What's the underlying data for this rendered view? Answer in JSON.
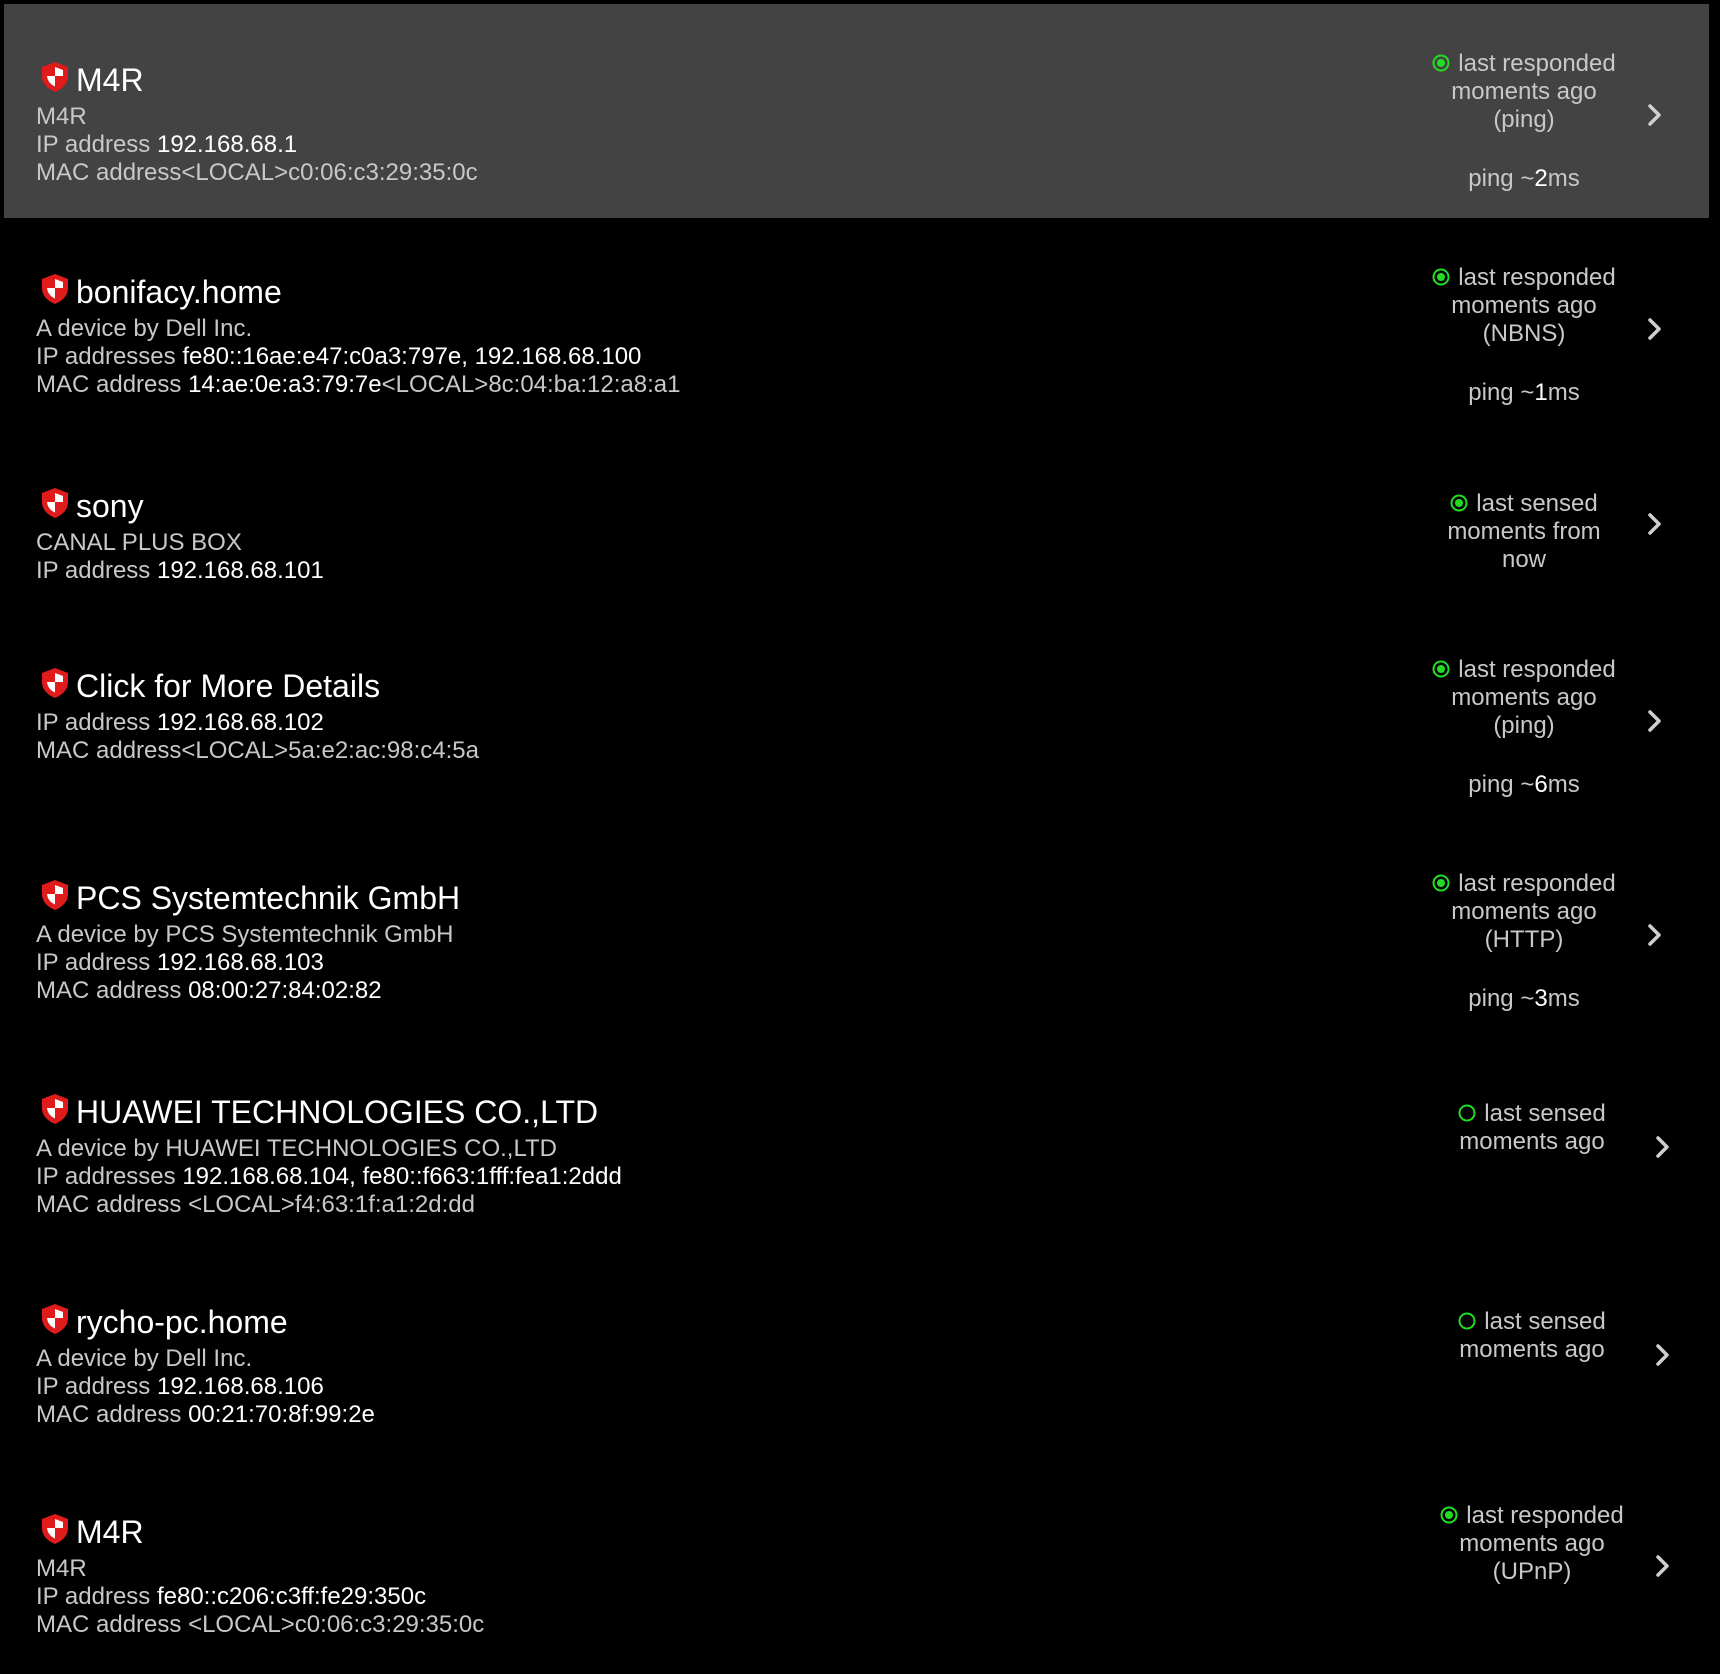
{
  "colors": {
    "background": "#000000",
    "selected_row": "#434343",
    "status_green": "#22dd22",
    "shield_red": "#e01b1b",
    "secondary_text": "#c8c8c8",
    "primary_text": "#ffffff"
  },
  "devices": [
    {
      "name": "M4R",
      "subtitle": "M4R",
      "ip_label": "IP address ",
      "ip_value": "192.168.68.1",
      "mac_label": "MAC address",
      "mac_primary": "",
      "mac_local": "<LOCAL>c0:06:c3:29:35:0c",
      "status_icon": "filled-circle-icon",
      "status_lines": [
        "last responded",
        "moments ago",
        "(ping)"
      ],
      "ping_prefix": "ping ~",
      "ping_value": "2",
      "ping_suffix": "ms",
      "selected": true
    },
    {
      "name": "bonifacy.home",
      "subtitle": "A device by Dell Inc.",
      "ip_label": "IP addresses ",
      "ip_value": "fe80::16ae:e47:c0a3:797e, 192.168.68.100",
      "mac_label": "MAC address ",
      "mac_primary": "14:ae:0e:a3:79:7e",
      "mac_local": "<LOCAL>8c:04:ba:12:a8:a1",
      "status_icon": "filled-circle-icon",
      "status_lines": [
        "last responded",
        "moments ago",
        "(NBNS)"
      ],
      "ping_prefix": "ping ~",
      "ping_value": "1",
      "ping_suffix": "ms"
    },
    {
      "name": "sony",
      "subtitle": "CANAL PLUS BOX",
      "ip_label": "IP address ",
      "ip_value": "192.168.68.101",
      "status_icon": "filled-circle-icon",
      "status_lines": [
        "last sensed",
        "moments from",
        "now"
      ]
    },
    {
      "name": "Click for More Details",
      "ip_label": "IP address ",
      "ip_value": "192.168.68.102",
      "mac_label": "MAC address",
      "mac_primary": "",
      "mac_local": "<LOCAL>5a:e2:ac:98:c4:5a",
      "status_icon": "filled-circle-icon",
      "status_lines": [
        "last responded",
        "moments ago",
        "(ping)"
      ],
      "ping_prefix": "ping ~",
      "ping_value": "6",
      "ping_suffix": "ms"
    },
    {
      "name": "PCS Systemtechnik GmbH",
      "subtitle": "A device by PCS Systemtechnik GmbH",
      "ip_label": "IP address ",
      "ip_value": "192.168.68.103",
      "mac_label": "MAC address ",
      "mac_primary": "08:00:27:84:02:82",
      "mac_local": "",
      "status_icon": "filled-circle-icon",
      "status_lines": [
        "last responded",
        "moments ago",
        "(HTTP)"
      ],
      "ping_prefix": "ping ~",
      "ping_value": "3",
      "ping_suffix": "ms"
    },
    {
      "name": "HUAWEI TECHNOLOGIES CO.,LTD",
      "subtitle": "A device by HUAWEI TECHNOLOGIES CO.,LTD",
      "ip_label": "IP addresses ",
      "ip_value": "192.168.68.104, fe80::f663:1fff:fea1:2ddd",
      "mac_label": "MAC address ",
      "mac_primary": "",
      "mac_local": "<LOCAL>f4:63:1f:a1:2d:dd",
      "status_icon": "hollow-circle-icon",
      "status_lines": [
        "last sensed",
        "moments ago"
      ]
    },
    {
      "name": "rycho-pc.home",
      "subtitle": "A device by Dell Inc.",
      "ip_label": "IP address ",
      "ip_value": "192.168.68.106",
      "mac_label": "MAC address ",
      "mac_primary": "00:21:70:8f:99:2e",
      "mac_local": "",
      "status_icon": "hollow-circle-icon",
      "status_lines": [
        "last sensed",
        "moments ago"
      ]
    },
    {
      "name": "M4R",
      "subtitle": "M4R",
      "ip_label": "IP address ",
      "ip_value": "fe80::c206:c3ff:fe29:350c",
      "mac_label": "MAC address ",
      "mac_primary": "",
      "mac_local": "<LOCAL>c0:06:c3:29:35:0c",
      "status_icon": "filled-circle-icon",
      "status_lines": [
        "last responded",
        "moments ago",
        "(UPnP)"
      ]
    }
  ]
}
